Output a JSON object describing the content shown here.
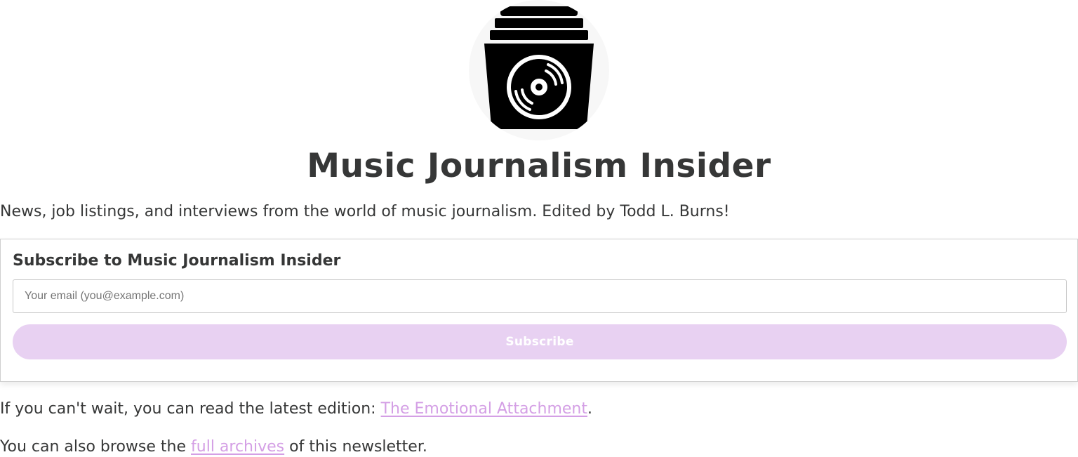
{
  "logo": {
    "icon": "record-crate-icon",
    "bg_color": "#f7f7f7",
    "fg_color": "#000000"
  },
  "header": {
    "title": "Music Journalism Insider",
    "tagline": "News, job listings, and interviews from the world of music journalism. Edited by Todd L. Burns!"
  },
  "subscribe": {
    "heading": "Subscribe to Music Journalism Insider",
    "email_placeholder": "Your email (you@example.com)",
    "email_value": "",
    "button_label": "Subscribe",
    "button_color": "#e8d1f2"
  },
  "footer": {
    "latest_prefix": "If you can't wait, you can read the latest edition: ",
    "latest_link": "The Emotional Attachment",
    "latest_suffix": ".",
    "archive_prefix": "You can also browse the ",
    "archive_link": "full archives",
    "archive_suffix": " of this newsletter."
  },
  "colors": {
    "text": "#363737",
    "link": "#d49fe5"
  }
}
